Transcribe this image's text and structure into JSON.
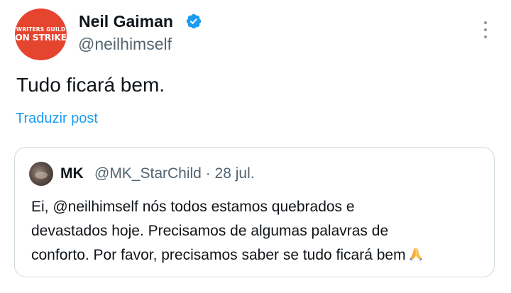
{
  "author": {
    "avatar_line1": "WRITERS GUILD",
    "avatar_line2": "ON STRIKE",
    "name": "Neil Gaiman",
    "handle": "@neilhimself",
    "verified_icon": "verified-badge-icon"
  },
  "more_icon": "more-options-icon",
  "tweet": {
    "text": "Tudo ficará bem.",
    "translate_label": "Traduzir post"
  },
  "quoted": {
    "name": "MK",
    "meta": "@MK_StarChild · 28 jul.",
    "lines": [
      "Ei, @neilhimself nós todos estamos quebrados e",
      "devastados hoje. Precisamos de algumas palavras de",
      "conforto. Por favor, precisamos saber se tudo ficará bem"
    ],
    "emoji_icon": "folded-hands-icon"
  },
  "colors": {
    "text": "#0f1419",
    "secondary": "#536471",
    "link": "#1d9bf0",
    "verified": "#1d9bf0",
    "border": "#cfd9de",
    "avatar_bg": "#e5442f"
  }
}
